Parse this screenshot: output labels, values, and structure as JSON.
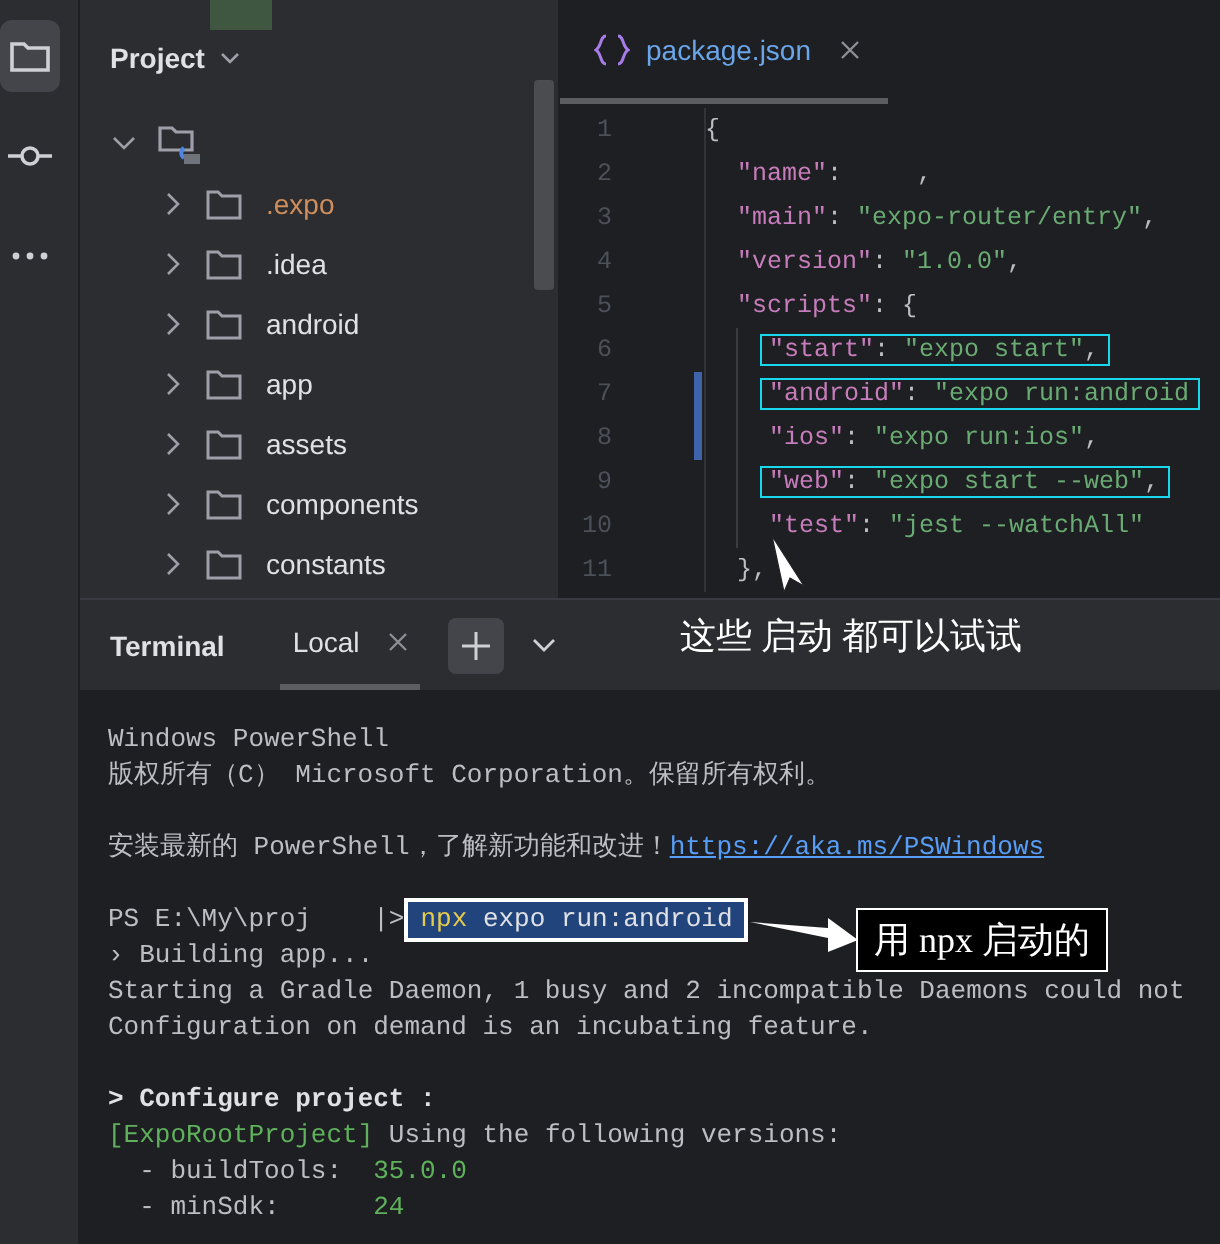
{
  "rail": [
    {
      "kind": "folder",
      "selected": true
    },
    {
      "kind": "commit",
      "selected": false
    },
    {
      "kind": "more",
      "selected": false
    }
  ],
  "project": {
    "title": "Project",
    "tree": {
      "expanded": true,
      "children": [
        {
          "label": ".expo",
          "ignored": true,
          "expanded": false
        },
        {
          "label": ".idea",
          "ignored": false,
          "expanded": false
        },
        {
          "label": "android",
          "ignored": false,
          "expanded": false
        },
        {
          "label": "app",
          "ignored": false,
          "expanded": false
        },
        {
          "label": "assets",
          "ignored": false,
          "expanded": false
        },
        {
          "label": "components",
          "ignored": false,
          "expanded": false
        },
        {
          "label": "constants",
          "ignored": false,
          "expanded": false
        }
      ]
    }
  },
  "editor": {
    "tabs": [
      {
        "label": "package.json",
        "selected": true
      }
    ],
    "lines": [
      {
        "number": "1",
        "boxed": false,
        "changed": false,
        "tokens": [
          {
            "kind": "punct",
            "text": "{"
          }
        ],
        "children": [
          {
            "number": "2",
            "boxed": false,
            "changed": false,
            "tokens": [
              {
                "kind": "key",
                "text": "\"name\""
              },
              {
                "kind": "punct",
                "text": ":     ,"
              }
            ]
          },
          {
            "number": "3",
            "boxed": false,
            "changed": false,
            "tokens": [
              {
                "kind": "key",
                "text": "\"main\""
              },
              {
                "kind": "punct",
                "text": ": "
              },
              {
                "kind": "string",
                "text": "\"expo-router/entry\""
              },
              {
                "kind": "punct",
                "text": ","
              }
            ]
          },
          {
            "number": "4",
            "boxed": false,
            "changed": false,
            "tokens": [
              {
                "kind": "key",
                "text": "\"version\""
              },
              {
                "kind": "punct",
                "text": ": "
              },
              {
                "kind": "string",
                "text": "\"1.0.0\""
              },
              {
                "kind": "punct",
                "text": ","
              }
            ]
          },
          {
            "number": "5",
            "boxed": false,
            "changed": false,
            "tokens": [
              {
                "kind": "key",
                "text": "\"scripts\""
              },
              {
                "kind": "punct",
                "text": ": {"
              }
            ],
            "children": [
              {
                "number": "6",
                "boxed": true,
                "changed": false,
                "tokens": [
                  {
                    "kind": "key",
                    "text": "\"start\""
                  },
                  {
                    "kind": "punct",
                    "text": ": "
                  },
                  {
                    "kind": "string",
                    "text": "\"expo start\""
                  },
                  {
                    "kind": "punct",
                    "text": ","
                  }
                ]
              },
              {
                "number": "7",
                "boxed": true,
                "changed": true,
                "tokens": [
                  {
                    "kind": "key",
                    "text": "\"android\""
                  },
                  {
                    "kind": "punct",
                    "text": ": "
                  },
                  {
                    "kind": "string",
                    "text": "\"expo run:android"
                  }
                ]
              },
              {
                "number": "8",
                "boxed": false,
                "changed": true,
                "tokens": [
                  {
                    "kind": "key",
                    "text": "\"ios\""
                  },
                  {
                    "kind": "punct",
                    "text": ": "
                  },
                  {
                    "kind": "string",
                    "text": "\"expo run:ios\""
                  },
                  {
                    "kind": "punct",
                    "text": ","
                  }
                ]
              },
              {
                "number": "9",
                "boxed": true,
                "changed": false,
                "tokens": [
                  {
                    "kind": "key",
                    "text": "\"web\""
                  },
                  {
                    "kind": "punct",
                    "text": ": "
                  },
                  {
                    "kind": "string",
                    "text": "\"expo start --web\""
                  },
                  {
                    "kind": "punct",
                    "text": ","
                  }
                ]
              },
              {
                "number": "10",
                "boxed": false,
                "changed": false,
                "tokens": [
                  {
                    "kind": "key",
                    "text": "\"test\""
                  },
                  {
                    "kind": "punct",
                    "text": ": "
                  },
                  {
                    "kind": "string",
                    "text": "\"jest --watchAll\""
                  }
                ]
              }
            ]
          },
          {
            "number": "11",
            "boxed": false,
            "changed": false,
            "tokens": [
              {
                "kind": "punct",
                "text": "},"
              }
            ]
          }
        ]
      }
    ]
  },
  "terminal": {
    "title": "Terminal",
    "tabs": [
      {
        "label": "Local",
        "selected": true
      }
    ],
    "lines": [
      {
        "kind": "text",
        "tokens": [
          {
            "kind": "plain",
            "text": "Windows PowerShell"
          }
        ]
      },
      {
        "kind": "text",
        "tokens": [
          {
            "kind": "plain",
            "text": "版权所有（C） Microsoft Corporation。保留所有权利。"
          }
        ]
      },
      {
        "kind": "blank"
      },
      {
        "kind": "text",
        "tokens": [
          {
            "kind": "plain",
            "text": "安装最新的 PowerShell，了解新功能和改进！"
          },
          {
            "kind": "link",
            "text": "https://aka.ms/PSWindows"
          }
        ]
      },
      {
        "kind": "blank"
      },
      {
        "kind": "text",
        "tokens": [
          {
            "kind": "plain",
            "text": "PS E:\\My\\proj    |>"
          },
          {
            "kind": "command",
            "program": "npx",
            "text": "expo run:android"
          }
        ]
      },
      {
        "kind": "text",
        "tokens": [
          {
            "kind": "plain",
            "text": "› Building app..."
          }
        ]
      },
      {
        "kind": "text",
        "tokens": [
          {
            "kind": "plain",
            "text": "Starting a Gradle Daemon, 1 busy and 2 incompatible Daemons could not"
          }
        ]
      },
      {
        "kind": "text",
        "tokens": [
          {
            "kind": "plain",
            "text": "Configuration on demand is an incubating feature."
          }
        ]
      },
      {
        "kind": "blank"
      },
      {
        "kind": "text",
        "tokens": [
          {
            "kind": "bold",
            "text": "> Configure project :"
          }
        ]
      },
      {
        "kind": "text",
        "tokens": [
          {
            "kind": "green",
            "text": "[ExpoRootProject]"
          },
          {
            "kind": "plain",
            "text": " Using the following versions:"
          }
        ]
      },
      {
        "kind": "text",
        "tokens": [
          {
            "kind": "plain",
            "text": "  - buildTools:  "
          },
          {
            "kind": "green",
            "text": "35.0.0"
          }
        ]
      },
      {
        "kind": "text",
        "tokens": [
          {
            "kind": "plain",
            "text": "  - minSdk:      "
          },
          {
            "kind": "green",
            "text": "24"
          }
        ]
      }
    ]
  },
  "annotations": {
    "note": "这些 启动 都可以试试",
    "callout": "用 npx 启动的"
  }
}
